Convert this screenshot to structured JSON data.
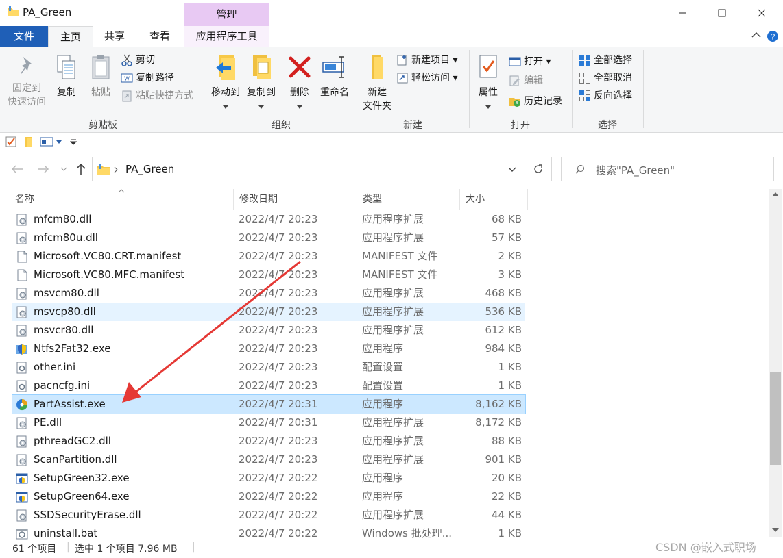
{
  "window": {
    "title": "PA_Green",
    "manage_tab": "管理",
    "controls": [
      "minimize-icon",
      "maximize-icon",
      "close-icon"
    ]
  },
  "tabs": {
    "file": "文件",
    "home": "主页",
    "share": "共享",
    "view": "查看",
    "app_tools": "应用程序工具"
  },
  "ribbon": {
    "clipboard": {
      "label": "剪贴板",
      "pin": "固定到",
      "pin2": "快速访问",
      "copy": "复制",
      "paste": "粘贴",
      "cut": "剪切",
      "copy_path": "复制路径",
      "paste_shortcut": "粘贴快捷方式"
    },
    "organize": {
      "label": "组织",
      "move_to": "移动到",
      "copy_to": "复制到",
      "delete": "删除",
      "rename": "重命名"
    },
    "new": {
      "label": "新建",
      "new_folder": "新建",
      "new_folder2": "文件夹",
      "new_item": "新建项目",
      "easy_access": "轻松访问"
    },
    "open": {
      "label": "打开",
      "properties": "属性",
      "open": "打开",
      "edit": "编辑",
      "history": "历史记录"
    },
    "select": {
      "label": "选择",
      "select_all": "全部选择",
      "select_none": "全部取消",
      "invert": "反向选择"
    }
  },
  "address": {
    "path": "PA_Green",
    "search_placeholder": "搜索\"PA_Green\""
  },
  "columns": {
    "name": "名称",
    "date": "修改日期",
    "type": "类型",
    "size": "大小"
  },
  "files": [
    {
      "name": "mfcm80.dll",
      "date": "2022/4/7 20:23",
      "type": "应用程序扩展",
      "size": "68 KB",
      "icon": "dll-icon"
    },
    {
      "name": "mfcm80u.dll",
      "date": "2022/4/7 20:23",
      "type": "应用程序扩展",
      "size": "57 KB",
      "icon": "dll-icon"
    },
    {
      "name": "Microsoft.VC80.CRT.manifest",
      "date": "2022/4/7 20:23",
      "type": "MANIFEST 文件",
      "size": "2 KB",
      "icon": "file-icon"
    },
    {
      "name": "Microsoft.VC80.MFC.manifest",
      "date": "2022/4/7 20:23",
      "type": "MANIFEST 文件",
      "size": "3 KB",
      "icon": "file-icon"
    },
    {
      "name": "msvcm80.dll",
      "date": "2022/4/7 20:23",
      "type": "应用程序扩展",
      "size": "468 KB",
      "icon": "dll-icon"
    },
    {
      "name": "msvcp80.dll",
      "date": "2022/4/7 20:23",
      "type": "应用程序扩展",
      "size": "536 KB",
      "icon": "dll-icon",
      "state": "hover"
    },
    {
      "name": "msvcr80.dll",
      "date": "2022/4/7 20:23",
      "type": "应用程序扩展",
      "size": "612 KB",
      "icon": "dll-icon"
    },
    {
      "name": "Ntfs2Fat32.exe",
      "date": "2022/4/7 20:23",
      "type": "应用程序",
      "size": "984 KB",
      "icon": "shield-exe-icon"
    },
    {
      "name": "other.ini",
      "date": "2022/4/7 20:23",
      "type": "配置设置",
      "size": "1 KB",
      "icon": "ini-icon"
    },
    {
      "name": "pacncfg.ini",
      "date": "2022/4/7 20:23",
      "type": "配置设置",
      "size": "1 KB",
      "icon": "ini-icon"
    },
    {
      "name": "PartAssist.exe",
      "date": "2022/4/7 20:31",
      "type": "应用程序",
      "size": "8,162 KB",
      "icon": "partassist-icon",
      "state": "selected"
    },
    {
      "name": "PE.dll",
      "date": "2022/4/7 20:31",
      "type": "应用程序扩展",
      "size": "8,172 KB",
      "icon": "dll-icon"
    },
    {
      "name": "pthreadGC2.dll",
      "date": "2022/4/7 20:23",
      "type": "应用程序扩展",
      "size": "88 KB",
      "icon": "dll-icon"
    },
    {
      "name": "ScanPartition.dll",
      "date": "2022/4/7 20:23",
      "type": "应用程序扩展",
      "size": "901 KB",
      "icon": "dll-icon"
    },
    {
      "name": "SetupGreen32.exe",
      "date": "2022/4/7 20:22",
      "type": "应用程序",
      "size": "20 KB",
      "icon": "setup-exe-icon"
    },
    {
      "name": "SetupGreen64.exe",
      "date": "2022/4/7 20:22",
      "type": "应用程序",
      "size": "22 KB",
      "icon": "setup-exe-icon"
    },
    {
      "name": "SSDSecurityErase.dll",
      "date": "2022/4/7 20:22",
      "type": "应用程序扩展",
      "size": "44 KB",
      "icon": "dll-icon"
    },
    {
      "name": "uninstall.bat",
      "date": "2022/4/7 20:22",
      "type": "Windows 批处理...",
      "size": "1 KB",
      "icon": "bat-icon"
    }
  ],
  "status": {
    "count": "61 个项目",
    "selection": "选中 1 个项目  7.96 MB"
  },
  "watermark": "CSDN @嵌入式职场",
  "colors": {
    "file_tab": "#1f5fb7",
    "manage_tab": "#e8c9f3",
    "selection": "#cce8ff",
    "arrow": "#e53935"
  }
}
